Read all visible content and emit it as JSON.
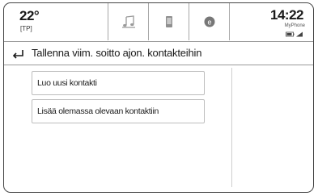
{
  "status": {
    "temperature": "22°",
    "temperature_sub": "[TP]",
    "time": "14:22",
    "phone_name": "MyPhone",
    "tabs": [
      {
        "icon": "music-note-icon"
      },
      {
        "icon": "phone-icon"
      },
      {
        "icon": "app-icon"
      }
    ]
  },
  "header": {
    "title": "Tallenna viim. soitto ajon. kontakteihin"
  },
  "menu": {
    "items": [
      {
        "label": "Luo uusi kontakti"
      },
      {
        "label": "Lisää olemassa olevaan kontaktiin"
      }
    ]
  }
}
